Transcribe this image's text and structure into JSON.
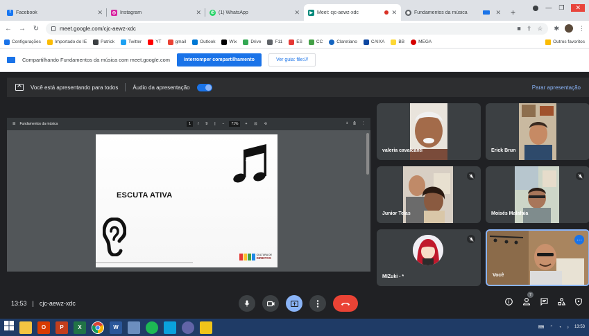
{
  "browser": {
    "tabs": [
      {
        "title": "Facebook",
        "color": "#1877f2",
        "icon": "facebook-icon"
      },
      {
        "title": "Instagram",
        "color": "#d6249f",
        "icon": "instagram-icon"
      },
      {
        "title": "(1) WhatsApp",
        "color": "#25d366",
        "icon": "whatsapp-icon"
      },
      {
        "title": "Meet: cjc-aewz-xdc",
        "color": "#00897b",
        "icon": "meet-icon",
        "active": true
      },
      {
        "title": "Fundamentos da música",
        "color": "#5f6368",
        "icon": "drive-icon"
      }
    ],
    "url": "meet.google.com/cjc-aewz-xdc"
  },
  "bookmarks": {
    "items": [
      {
        "label": "Configurações",
        "color": "#1a73e8"
      },
      {
        "label": "Importado do IE",
        "color": "#fbbc04"
      },
      {
        "label": "Patrick",
        "color": "#3c4043"
      },
      {
        "label": "Twitter",
        "color": "#1da1f2"
      },
      {
        "label": "YT",
        "color": "#ff0000"
      },
      {
        "label": "gmail",
        "color": "#ea4335"
      },
      {
        "label": "Outlook",
        "color": "#0078d4"
      },
      {
        "label": "Wix",
        "color": "#000000"
      },
      {
        "label": "Drive",
        "color": "#34a853"
      },
      {
        "label": "F11",
        "color": "#5f6368"
      },
      {
        "label": "ES",
        "color": "#e53935"
      },
      {
        "label": "CC",
        "color": "#43a047"
      },
      {
        "label": "Claretiano",
        "color": "#1565c0"
      },
      {
        "label": "CAIXA",
        "color": "#0d47a1"
      },
      {
        "label": "BB",
        "color": "#fdd835"
      },
      {
        "label": "MEGA",
        "color": "#d50000"
      }
    ],
    "other": "Outros favoritos"
  },
  "share_bar": {
    "message": "Compartilhando Fundamentos da música com meet.google.com",
    "stop_button": "Interromper compartilhamento",
    "view_tab_button": "Ver guia: file:///"
  },
  "presenting": {
    "message": "Você está apresentando para todos",
    "audio_label": "Áudio da apresentação",
    "stop_label": "Parar apresentação"
  },
  "document": {
    "name": "Fundamentos da música",
    "page_current": "1",
    "page_total": "9",
    "zoom": "71%",
    "slide_title": "ESCUTA ATIVA",
    "logo_line1": "CULTURA DE",
    "logo_line2": "DIREITOS"
  },
  "participants": [
    {
      "name": "valeria cavalcanti",
      "muted": false
    },
    {
      "name": "Erick Brun",
      "muted": false
    },
    {
      "name": "Junior Telas",
      "muted": true
    },
    {
      "name": "Moisés Malafaia",
      "muted": true
    },
    {
      "name": "MIZuki - *",
      "muted": true
    },
    {
      "name": "Você",
      "muted": false,
      "self": true
    }
  ],
  "meeting": {
    "time": "13:53",
    "code": "cjc-aewz-xdc",
    "participant_count": "7"
  },
  "taskbar": {
    "clock_time": "13:53"
  }
}
